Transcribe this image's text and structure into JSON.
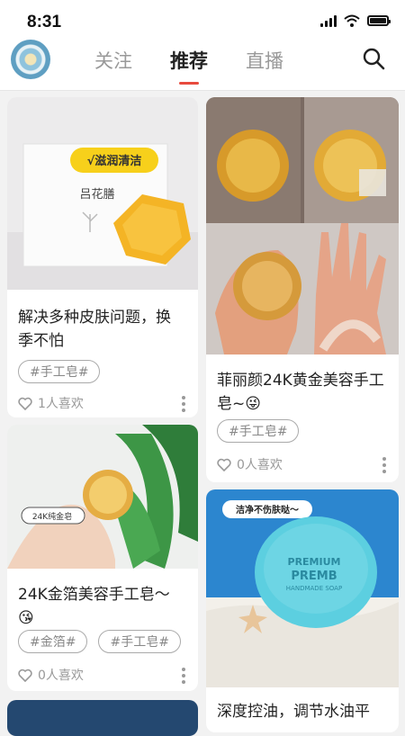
{
  "status": {
    "time": "8:31"
  },
  "nav": {
    "tabs": [
      "关注",
      "推荐",
      "直播"
    ],
    "active_tab": "推荐"
  },
  "cards": [
    {
      "title": "解决多种皮肤问题，换季不怕",
      "tags": [
        "#手工皂#"
      ],
      "likes": "1人喜欢",
      "image": {
        "banner": "√滋润清洁",
        "brand": "吕花膳"
      }
    },
    {
      "title": "菲丽颜24K黄金美容手工皂~😜",
      "tags": [
        "#手工皂#"
      ],
      "likes": "0人喜欢"
    },
    {
      "title": "24K金箔美容手工皂～😘",
      "tags": [
        "#金箔#",
        "#手工皂#"
      ],
      "likes": "0人喜欢",
      "image": {
        "label": "24K纯金皂"
      }
    },
    {
      "title": "深度控油，调节水油平",
      "tags": [],
      "likes": "",
      "image": {
        "bubble": "洁净不伤肤哒～",
        "soap_line1": "PREMIUM",
        "soap_line2": "PREMB",
        "soap_line3": "HANDMADE SOAP"
      }
    }
  ],
  "colors": {
    "accent": "#e84a3d",
    "soap_blue": "#5ccfe0",
    "soap_gold": "#f4b425"
  }
}
